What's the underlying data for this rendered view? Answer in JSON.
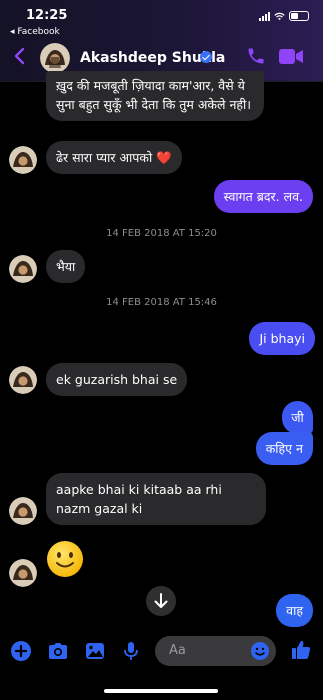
{
  "status_bar": {
    "time": "12:25",
    "back_app": "◂ Facebook"
  },
  "header": {
    "contact_name": "Akashdeep Shukla"
  },
  "messages": {
    "m1": "ख़ुद की मजबूती ज़ियादा काम'आर, वैसे ये सुना बहुत सुकूँ भी देता कि तुम अकेले नही।",
    "m2": "ढेर सारा प्यार आपको ❤️",
    "m3": "स्वागत ब्रदर. लव.",
    "ts1": "14 FEB 2018 AT 15:20",
    "m4": "भैया",
    "ts2": "14 FEB 2018 AT 15:46",
    "m5": "Ji bhayi",
    "m6": "ek guzarish bhai se",
    "m7": "जी",
    "m8": "कहिए न",
    "m9": "aapke bhai ki kitaab aa rhi nazm gazal ki",
    "m10": "वाह"
  },
  "composer": {
    "placeholder": "Aa"
  },
  "colors": {
    "accent": "#8f44f7",
    "bubble_top": "#6b3ff0",
    "bubble_bottom": "#2f64f1",
    "incoming": "#2a2a2c"
  },
  "icons": [
    "back-arrow-icon",
    "verified-icon",
    "phone-icon",
    "video-icon",
    "plus-icon",
    "camera-icon",
    "gallery-icon",
    "microphone-icon",
    "emoji-icon",
    "like-icon",
    "scroll-down-icon"
  ]
}
